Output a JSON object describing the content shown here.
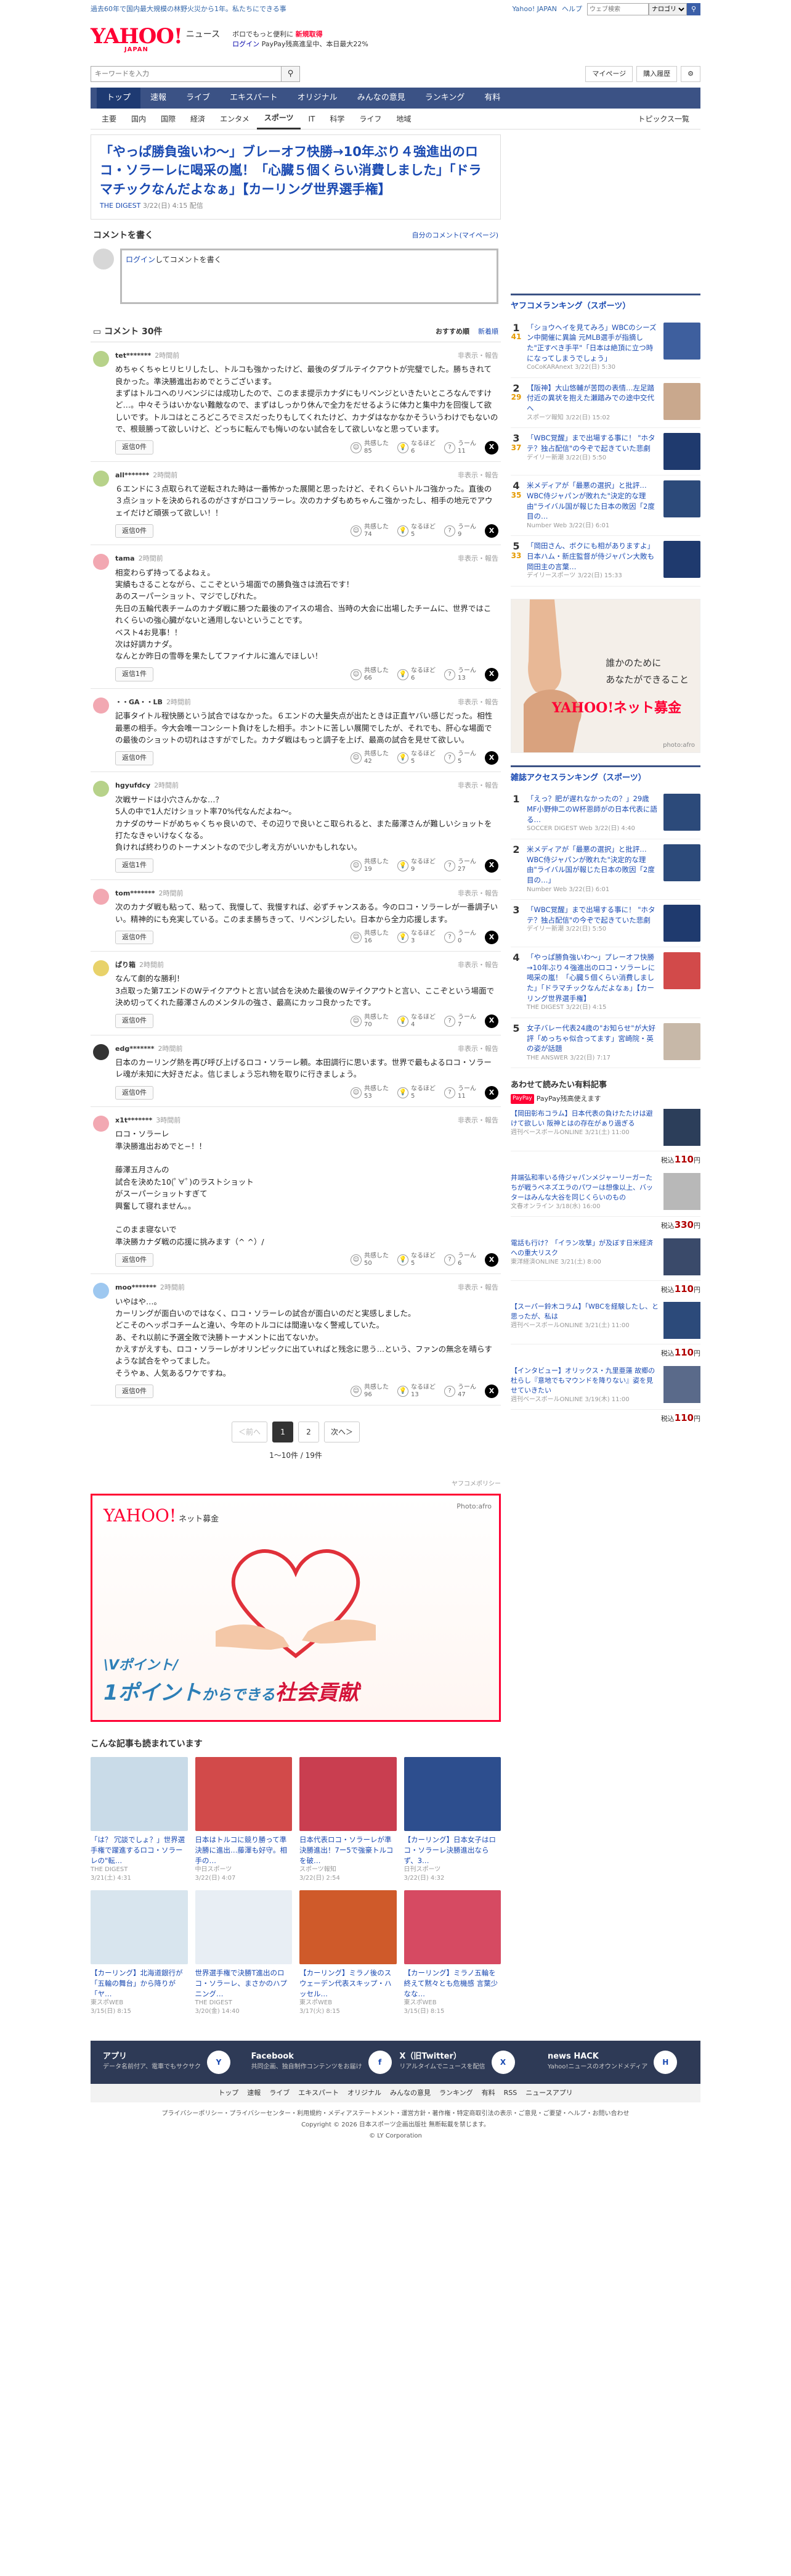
{
  "topbar": {
    "notice": "過去60年で国内最大規模の林野火災から1年。私たちにできる事",
    "links": [
      "Yahoo! JAPAN",
      "ヘルプ"
    ],
    "search_placeholder": "ウェブ検索",
    "search_target": "ナロゴリ",
    "search_btn": "検索"
  },
  "header": {
    "logo": "YAHOO!",
    "logo_sub": "JAPAN",
    "section": "ニュース",
    "promo_line1": "ボロでもっと便利に",
    "promo_new": "新規取得",
    "promo_line2_login": "ログイン",
    "promo_line2": "PayPay残高進呈中、本日最大22%"
  },
  "searchrow": {
    "placeholder": "キーワードを入力",
    "mypage": "マイページ",
    "purchase": "購入履歴",
    "gear": "設定"
  },
  "gnav": [
    "トップ",
    "速報",
    "ライブ",
    "エキスパート",
    "オリジナル",
    "みんなの意見",
    "ランキング",
    "有料"
  ],
  "snav": [
    "主要",
    "国内",
    "国際",
    "経済",
    "エンタメ",
    "スポーツ",
    "IT",
    "科学",
    "ライフ",
    "地域"
  ],
  "snav_active": "スポーツ",
  "snav_right": "トピックス一覧",
  "article": {
    "title": "「やっぱ勝負強いわ〜」ブレーオフ快勝→10年ぶり４強進出のロコ・ソラーレに喝采の嵐！「心臓５個くらい消費しました」「ドラマチックなんだよなぁ」【カーリング世界選手権】",
    "source": "THE DIGEST",
    "date": "3/22(日) 4:15 配信"
  },
  "comment_write": {
    "title": "コメントを書く",
    "mine": "自分のコメント(マイページ)",
    "login": "ログイン",
    "placeholder": "してコメントを書く"
  },
  "comment_list": {
    "title": "コメント 30件",
    "sort_on": "おすすめ順",
    "sort_off": "新着順"
  },
  "comments": [
    {
      "user": "tet*******",
      "time": "2時間前",
      "report": "非表示・報告",
      "text": "めちゃくちゃヒリヒリしたし、トルコも強かったけど、最後のダブルテイクアウトが完璧でした。勝ちきれて良かった。準決勝進出おめでとうございます。\nまずはトルコへのリベンジには成功したので、このまま提示カナダにもリベンジといきたいところなんですけど…。中々そうはいかない難敵なので、まずはしっかり休んで全力をだせるように体力と集中力を回復して欲しいです。トルコはところどころでミスだったりもしてくれたけど、カナダはなかなかそういうわけでもないので、根競勝って欲しいけど、どっちに転んでも悔いのない試合をして欲しいなと思っています。",
      "reply": "返信0件",
      "r1l": "共感した",
      "r1": "85",
      "r2l": "なるほど",
      "r2": "6",
      "r3l": "うーん",
      "r3": "11",
      "color": "#b7d28a"
    },
    {
      "user": "all*******",
      "time": "2時間前",
      "report": "非表示・報告",
      "text": "６エンドに３点取られて逆転された時は一番怖かった展開と思ったけど、それくらいトルコ強かった。直後の３点ショットを決められるのがさすがロコソラーレ。次のカナダもめちゃんこ強かったし、相手の地元でアウェイだけど頑張って欲しい！！",
      "reply": "返信0件",
      "r1l": "共感した",
      "r1": "74",
      "r2l": "なるほど",
      "r2": "5",
      "r3l": "うーん",
      "r3": "9",
      "color": "#b7d28a"
    },
    {
      "user": "tama",
      "time": "2時間前",
      "report": "非表示・報告",
      "text": "相変わらず持ってるよねぇ。\n実績もさることながら、ここぞという場面での勝負強さは流石です！\nあのスーパーショット、マジでしびれた。\n先日の五輪代表チームのカナダ戦に勝つた最後のアイスの場合、当時の大会に出場したチームに、世界ではこれくらいの強心臓がないと通用しないということです。\nベスト4お見事！！\n次は好調カナダ。\nなんとか昨日の雪辱を果たしてファイナルに進んでほしい！",
      "reply": "返信1件",
      "r1l": "共感した",
      "r1": "66",
      "r2l": "なるほど",
      "r2": "6",
      "r3l": "うーん",
      "r3": "13",
      "color": "#f2a8b2"
    },
    {
      "user": "・・GA・・LB",
      "time": "2時間前",
      "report": "非表示・報告",
      "text": "記事タイトル程快勝という試合ではなかった。６エンドの大量失点が出たときは正直ヤバい感じだった。相性最悪の相手。今大会唯一コンシート負けをした相手。ホントに苦しい展開でしたが、それでも、肝心な場面での最後のショットの切れはさすがでした。カナダ戦はもっと調子を上げ、最高の試合を見せて欲しい。",
      "reply": "返信0件",
      "r1l": "共感した",
      "r1": "42",
      "r2l": "なるほど",
      "r2": "5",
      "r3l": "うーん",
      "r3": "5",
      "color": "#f2a8b2"
    },
    {
      "user": "hgyufdcy",
      "time": "2時間前",
      "report": "非表示・報告",
      "text": "次戦サードは小穴さんかな…？\n5人の中で1人だけショット率70%代なんだよね〜。\nカナダのサードがめちゃくちゃ良いので、その辺りで良いとこ取られると、また藤澤さんが難しいショットを打たなきゃいけなくなる。\n負ければ終わりのトーナメントなので少し考え方がいいかもしれない。",
      "reply": "返信1件",
      "r1l": "共感した",
      "r1": "19",
      "r2l": "なるほど",
      "r2": "9",
      "r3l": "うーん",
      "r3": "27",
      "color": "#b7d28a"
    },
    {
      "user": "tom*******",
      "time": "2時間前",
      "report": "非表示・報告",
      "text": "次のカナダ戦も粘って、粘って、我慢して、我慢すれば、必ずチャンスある。今のロコ・ソラーレが一番調子いい。精神的にも充実している。このまま勝ちきって、リベンジしたい。日本から全力応援します。",
      "reply": "返信0件",
      "r1l": "共感した",
      "r1": "16",
      "r2l": "なるほど",
      "r2": "3",
      "r3l": "うーん",
      "r3": "0",
      "color": "#f2a8b2"
    },
    {
      "user": "ぱり箱",
      "time": "2時間前",
      "report": "非表示・報告",
      "text": "なんて劇的な勝利！\n3点取った第7エンドのWテイクアウトと言い試合を決めた最後のWテイクアウトと言い、ここぞという場面で決め切ってくれた藤澤さんのメンタルの強さ、最高にカッコ良かったです。",
      "reply": "返信0件",
      "r1l": "共感した",
      "r1": "70",
      "r2l": "なるほど",
      "r2": "4",
      "r3l": "うーん",
      "r3": "7",
      "color": "#e8d26a"
    },
    {
      "user": "edg*******",
      "time": "2時間前",
      "report": "非表示・報告",
      "text": "日本のカーリング熱を再び呼び上げるロコ・ソラーレ頼。本田調行に思います。世界で最もよるロコ・ソラーレ魂が未知に大好きだよ。信じましょう忘れ物を取りに行きましょう。",
      "reply": "返信0件",
      "r1l": "共感した",
      "r1": "53",
      "r2l": "なるほど",
      "r2": "5",
      "r3l": "うーん",
      "r3": "11",
      "color": "#333333"
    },
    {
      "user": "x1t*******",
      "time": "3時間前",
      "report": "非表示・報告",
      "text": "ロコ・ソラーレ\n準決勝進出おめでと−！！\n\n藤澤五月さんの\n試合を決めた10(ﾟ∀ﾟ)のラストショット\nがスーパーショットすぎて\n興奮して寝れません。。\n\nこのまま寝ないで\n準決勝カナダ戦の応援に挑みます（^ ^）/",
      "reply": "返信0件",
      "r1l": "共感した",
      "r1": "50",
      "r2l": "なるほど",
      "r2": "5",
      "r3l": "うーん",
      "r3": "6",
      "color": "#f2a8b2"
    },
    {
      "user": "moo*******",
      "time": "2時間前",
      "report": "非表示・報告",
      "text": "いやはや…。\nカーリングが面白いのではなく、ロコ・ソラーレの試合が面白いのだと実感しました。\nどこそのヘッポコチームと違い、今年のトルコには間違いなく警戒していた。\nあ、それ以前に予選全敗で決勝トーナメントに出てないか。\nかえすがえすも、ロコ・ソラーレがオリンピックに出ていればと残念に思う…という、ファンの無念を晴らすような試合をやってました。\nそうやぁ、人気あるワケですね。",
      "reply": "返信0件",
      "r1l": "共感した",
      "r1": "96",
      "r2l": "なるほど",
      "r2": "13",
      "r3l": "うーん",
      "r3": "47",
      "color": "#9ec8f0"
    }
  ],
  "pager": {
    "prev": "＜前へ",
    "pages": [
      "1",
      "2"
    ],
    "current": "1",
    "next": "次へ＞",
    "count": "1〜10件 / 19件"
  },
  "bigad": {
    "label": "ヤフコメポリシー",
    "brand": "YAHOO!",
    "brand_sub": "ネット募金",
    "photo": "Photo:afro",
    "line1": "\\Vポイント/",
    "line2a": "1ポイント",
    "line2b": "からできる",
    "line2c": "社会貢献"
  },
  "related": {
    "title": "こんな記事も読まれています",
    "items": [
      {
        "title": "「は？ 冗談でしょ？」世界選手権で躍進するロコ・ソラーレの\"転…",
        "src": "THE DIGEST",
        "date": "3/21(土) 4:31",
        "color": "#c9dbe8"
      },
      {
        "title": "日本はトルコに競り勝って準決勝に進出…藤澤も好守。相手の…",
        "src": "中日スポーツ",
        "date": "3/22(日) 4:07",
        "color": "#d24a4a"
      },
      {
        "title": "日本代表ロコ・ソラーレが準決勝進出！7ー5で強豪トルコを破…",
        "src": "スポーツ報知",
        "date": "3/22(日) 2:54",
        "color": "#c93e50"
      },
      {
        "title": "【カーリング】日本女子はロコ・ソラーレ決勝進出ならず、3…",
        "src": "日刊スポーツ",
        "date": "3/22(日) 4:32",
        "color": "#2d4e8e"
      },
      {
        "title": "【カーリング】北海道銀行が「五輪の舞台」から降りが「ヤ…",
        "src": "東スポWEB",
        "date": "3/15(日) 8:15",
        "color": "#d8e5ee"
      },
      {
        "title": "世界選手権で決勝T進出のロコ・ソラーレ、まさかのハプニング…",
        "src": "THE DIGEST",
        "date": "3/20(金) 14:40",
        "color": "#e8eef4"
      },
      {
        "title": "【カーリング】ミラノ後のスウェーデン代表スキップ・ハッセル…",
        "src": "東スポWEB",
        "date": "3/17(火) 8:15",
        "color": "#cf5a2a"
      },
      {
        "title": "【カーリング】ミラノ五輪を終えて黙々とも危機感 言葉少なな…",
        "src": "東スポWEB",
        "date": "3/15(日) 8:15",
        "color": "#d64a62"
      }
    ]
  },
  "ranking": {
    "title": "ヤフコメランキング（スポーツ）",
    "items": [
      {
        "n": "1",
        "c": "41",
        "title": "「ショウヘイを見てみろ」WBCのシーズン中開催に異論 元MLB選手が指摘した\"正すべき手平\"「日本は絶頂に立つ時になってしまうでしょう」",
        "src": "CoCoKARAnext 3/22(日) 5:30",
        "color": "#3e5f9e"
      },
      {
        "n": "2",
        "c": "29",
        "title": "【阪神】大山悠輔が苦悶の表情…左足踏付近の異状を抱えた瀬踏みでの途中交代へ",
        "src": "スポーツ報知 3/22(日) 15:02",
        "color": "#c9a88d"
      },
      {
        "n": "3",
        "c": "37",
        "title": "「WBC覚醒」まで出場する事に！ \"ホタテ？独占配信\"の今ぞで起きていた悲劇",
        "src": "デイリー新潮 3/22(日) 5:50",
        "color": "#1f3a6e"
      },
      {
        "n": "4",
        "c": "35",
        "title": "米メディアが「最悪の選択」と批評…WBC侍ジャパンが敗れた\"決定的な理由\"ライバル国が報じた日本の敗因「2度目の…",
        "src": "Number Web 3/22(日) 6:01",
        "color": "#2c4a7a"
      },
      {
        "n": "5",
        "c": "33",
        "title": "「岡田さん、ボクにも相がありますよ」日本ハム・新庄監督が侍ジャパン大敗も岡田主の言葉…",
        "src": "デイリースポーツ 3/22(日) 15:33",
        "color": "#1f3a6e"
      }
    ]
  },
  "sidead": {
    "line1": "誰かのために",
    "line2": "あなたができること",
    "brand": "YAHOO!ネット募金",
    "photo": "photo:afro"
  },
  "access": {
    "title": "雑誌アクセスランキング（スポーツ）",
    "items": [
      {
        "n": "1",
        "title": "「えっ？肥が遅れなかったの？」29歳MF小野伸二のW杯恩師がの日本代表に語る…",
        "src": "SOCCER DIGEST Web 3/22(日) 4:40",
        "color": "#2c4a7a"
      },
      {
        "n": "2",
        "title": "米メディアが「最悪の選択」と批評…WBC侍ジャパンが敗れた\"決定的な理由\"ライバル国が報じた日本の敗因「2度目の…」",
        "src": "Number Web 3/22(日) 6:01",
        "color": "#2c4a7a"
      },
      {
        "n": "3",
        "title": "「WBC覚醒」まで出場する事に！ \"ホタテ？独占配信\"の今ぞで起きていた悲劇",
        "src": "デイリー新潮 3/22(日) 5:50",
        "color": "#1f3a6e"
      },
      {
        "n": "4",
        "title": "「やっぱ勝負強いわ〜」プレーオフ快勝→10年ぶり４強進出のロコ・ソラーレに喝采の嵐！「心臓５個くらい消費しました」「ドラマチックなんだよなぁ」【カーリング世界選手権】",
        "src": "THE DIGEST 3/22(日) 4:15",
        "color": "#d24a4a"
      },
      {
        "n": "5",
        "title": "女子バレー代表24歳の\"お知らせ\"が大好評「めっちゃ似合ってます」宮崎院・英の姿が話題",
        "src": "THE ANSWER 3/22(日) 7:17",
        "color": "#c7b8a8"
      }
    ]
  },
  "paypay": {
    "title": "あわせて読みたい有料記事",
    "sub": "PayPay残高使えます",
    "logo": "PayPay",
    "items": [
      {
        "title": "【岡田彰布コラム】日本代表の負けたたけは避けて欲しい 阪神とはの存在がぁり過ぎる",
        "src": "週刊ベースボールONLINE 3/21(土) 11:00",
        "price": "110",
        "color": "#2c3e5a"
      },
      {
        "title": "井端弘和率いる侍ジャパンメジャーリーガーたちが戦うベネズエラのパワーは想像以上、バッターはみんな大谷を同じくらいのもの",
        "src": "文春オンライン 3/18(水) 16:00",
        "price": "330",
        "color": "#b8b8b8"
      },
      {
        "title": "電話も行け？「イラン攻撃」が及ぼす日米経済への重大リスク",
        "src": "東洋経済ONLINE 3/21(土) 8:00",
        "price": "110",
        "color": "#3a4a6a"
      },
      {
        "title": "【スーパー鈴木コラム】「WBCを経験したし、と思ったが、私は",
        "src": "週刊ベースボールONLINE 3/21(土) 11:00",
        "price": "110",
        "color": "#2c4a7a"
      },
      {
        "title": "【インタビュー】オリックス・九里亜蓮 故郷の杜らし『意地でもマウンドを降りない』姿を見せていきたい",
        "src": "週刊ベースボールONLINE 3/19(木) 11:00",
        "price": "110",
        "color": "#5a6a8a"
      }
    ],
    "price_prefix": "税込",
    "price_suffix": "円"
  },
  "footer": {
    "apps": [
      {
        "name": "アプリ",
        "desc": "データ名前付ア、電車でもサクサク",
        "icon": "Y"
      },
      {
        "name": "Facebook",
        "desc": "共同企画、独自制作コンテンツをお届け",
        "icon": "f"
      },
      {
        "name": "X（旧Twitter）",
        "desc": "リアルタイムでニュースを配信",
        "icon": "X"
      },
      {
        "name": "news HACK",
        "desc": "Yahoo!ニュースのオウンドメディア",
        "icon": "H"
      }
    ],
    "nav": [
      "トップ",
      "速報",
      "ライブ",
      "エキスパート",
      "オリジナル",
      "みんなの意見",
      "ランキング",
      "有料",
      "RSS",
      "ニュースアプリ"
    ],
    "legal1": "プライバシーポリシー・プライバシーセンター・利用規約・メディアステートメント・運営方針・著作権・特定商取引法の表示・ご意見・ご要望・ヘルプ・お問い合わせ",
    "copyright": "Copyright © 2026 日本スポーツ企画出版社 無断転載を禁じます。",
    "corp": "© LY Corporation"
  }
}
